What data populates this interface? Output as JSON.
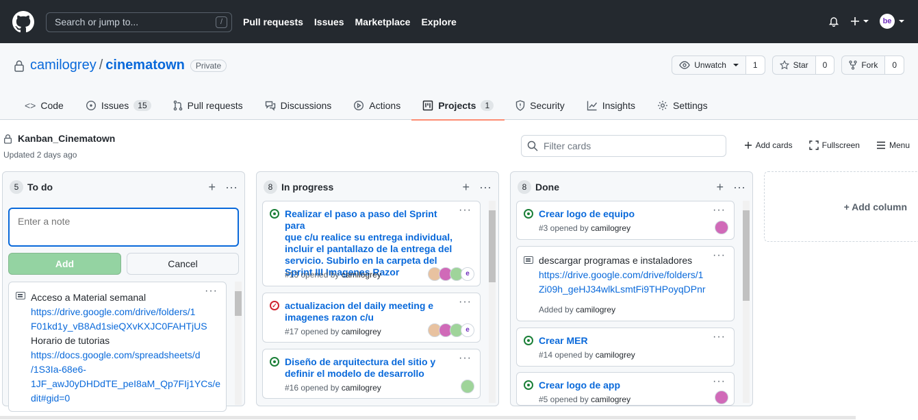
{
  "topbar": {
    "search_placeholder": "Search or jump to...",
    "slash_key": "/",
    "nav": [
      "Pull requests",
      "Issues",
      "Marketplace",
      "Explore"
    ],
    "avatar_text": "be"
  },
  "repo": {
    "owner": "camilogrey",
    "separator": "/",
    "name": "cinematown",
    "visibility": "Private",
    "watch_label": "Unwatch",
    "watch_count": "1",
    "star_label": "Star",
    "star_count": "0",
    "fork_label": "Fork",
    "fork_count": "0"
  },
  "tabs": {
    "code": "Code",
    "issues": "Issues",
    "issues_count": "15",
    "pulls": "Pull requests",
    "discussions": "Discussions",
    "actions": "Actions",
    "projects": "Projects",
    "projects_count": "1",
    "security": "Security",
    "insights": "Insights",
    "settings": "Settings"
  },
  "project": {
    "name": "Kanban_Cinematown",
    "updated": "Updated 2 days ago",
    "filter_placeholder": "Filter cards",
    "add_cards": "Add cards",
    "fullscreen": "Fullscreen",
    "menu": "Menu",
    "add_column": "+ Add column"
  },
  "columns": {
    "todo": {
      "count": "5",
      "title": "To do",
      "note_placeholder": "Enter a note",
      "add_label": "Add",
      "cancel_label": "Cancel",
      "note": {
        "line1": "Acceso a Material semanal",
        "link1a": "https://drive.google.com/drive/folders/1",
        "link1b": "F01kd1y_vB8Ad1sieQXvKXJC0FAHTjUS",
        "line2": "Horario de tutorias",
        "link2a": "https://docs.google.com/spreadsheets/d",
        "link2b": "/1S3Ia-68e6-",
        "link2c": "1JF_awJ0yDHDdTE_peI8aM_Qp7FIj1YCs/e",
        "link2d": "dit#gid=0"
      }
    },
    "progress": {
      "count": "8",
      "title": "In progress",
      "cards": [
        {
          "l1": "Realizar el paso a paso del Sprint para",
          "l2": "que c/u realice su entrega individual,",
          "l3": "incluir el pantallazo de la entrega del",
          "l4": "servicio. Subirlo en la carpeta del",
          "l5": "Sprint III Imagenes Razor",
          "meta": "#13 opened by",
          "author": "camilogrey"
        },
        {
          "l1": "actualizacion del daily meeting e",
          "l2": "imagenes razon c/u",
          "meta": "#17 opened by",
          "author": "camilogrey"
        },
        {
          "l1": "Diseño de arquitectura del sitio y",
          "l2": "definir el modelo de desarrollo",
          "meta": "#16 opened by",
          "author": "camilogrey"
        }
      ]
    },
    "done": {
      "count": "8",
      "title": "Done",
      "cards": [
        {
          "title": "Crear logo de equipo",
          "meta": "#3 opened by",
          "author": "camilogrey"
        },
        {
          "text": "descargar programas e instaladores",
          "link_a": "https://drive.google.com/drive/folders/1",
          "link_b": "Zi09h_geHJ34wlkLsmtFi9THPoyqDPnr",
          "added": "Added by",
          "author": "camilogrey"
        },
        {
          "title": "Crear MER",
          "meta": "#14 opened by",
          "author": "camilogrey"
        },
        {
          "title": "Crear logo de app",
          "meta": "#5 opened by",
          "author": "camilogrey"
        }
      ]
    }
  },
  "colors": {
    "header_bg": "#24292f",
    "link": "#0969da",
    "open_green": "#1a7f37",
    "closed_red": "#cf222e",
    "tab_underline": "#fd8c73"
  }
}
